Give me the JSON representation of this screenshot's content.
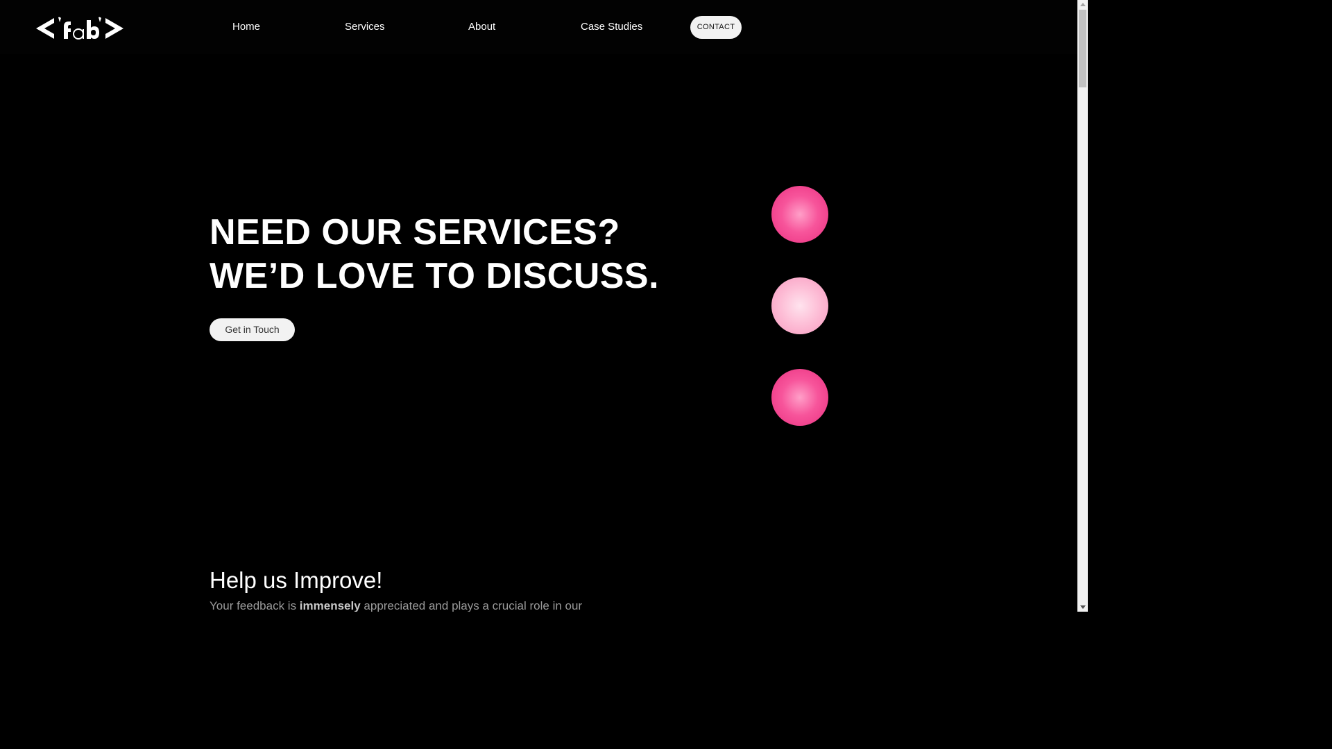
{
  "header": {
    "logo": {
      "icon": "fab-code-brackets-logo",
      "text": "<'fab'>"
    },
    "nav": {
      "home": "Home",
      "services": "Services",
      "about": "About",
      "case_studies": "Case Studies"
    },
    "contact_label": "CONTACT"
  },
  "hero": {
    "title_line1": "NEED OUR SERVICES?",
    "title_line2": "WE’D LOVE TO DISCUSS.",
    "cta_label": "Get in Touch",
    "orbs": [
      {
        "icon": "pink-orb",
        "color": "#f7559b"
      },
      {
        "icon": "light-pink-orb",
        "color": "#fdbcd5"
      },
      {
        "icon": "pink-orb",
        "color": "#f7559b"
      }
    ]
  },
  "feedback": {
    "title": "Help us Improve!",
    "text_before": "Your feedback is ",
    "text_bold": "immensely",
    "text_after": " appreciated and plays a crucial role in our"
  },
  "colors": {
    "background": "#000000",
    "accent_pink": "#f7559b",
    "button_bg": "#f2f2f2"
  }
}
